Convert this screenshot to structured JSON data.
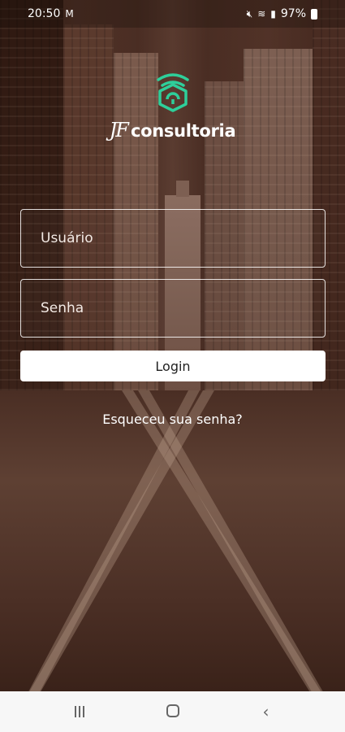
{
  "status_bar": {
    "time": "20:50",
    "notification_icon": "gmail-icon",
    "battery": "97%",
    "icons": [
      "mute-icon",
      "wifi-icon",
      "signal-icon",
      "battery-icon"
    ]
  },
  "brand": {
    "jf": "JF",
    "name": "consultoria",
    "accent_color": "#2ecf9a"
  },
  "form": {
    "username_placeholder": "Usuário",
    "password_placeholder": "Senha",
    "login_label": "Login",
    "forgot_label": "Esqueceu sua senha?"
  },
  "nav": {
    "back_glyph": "‹"
  }
}
